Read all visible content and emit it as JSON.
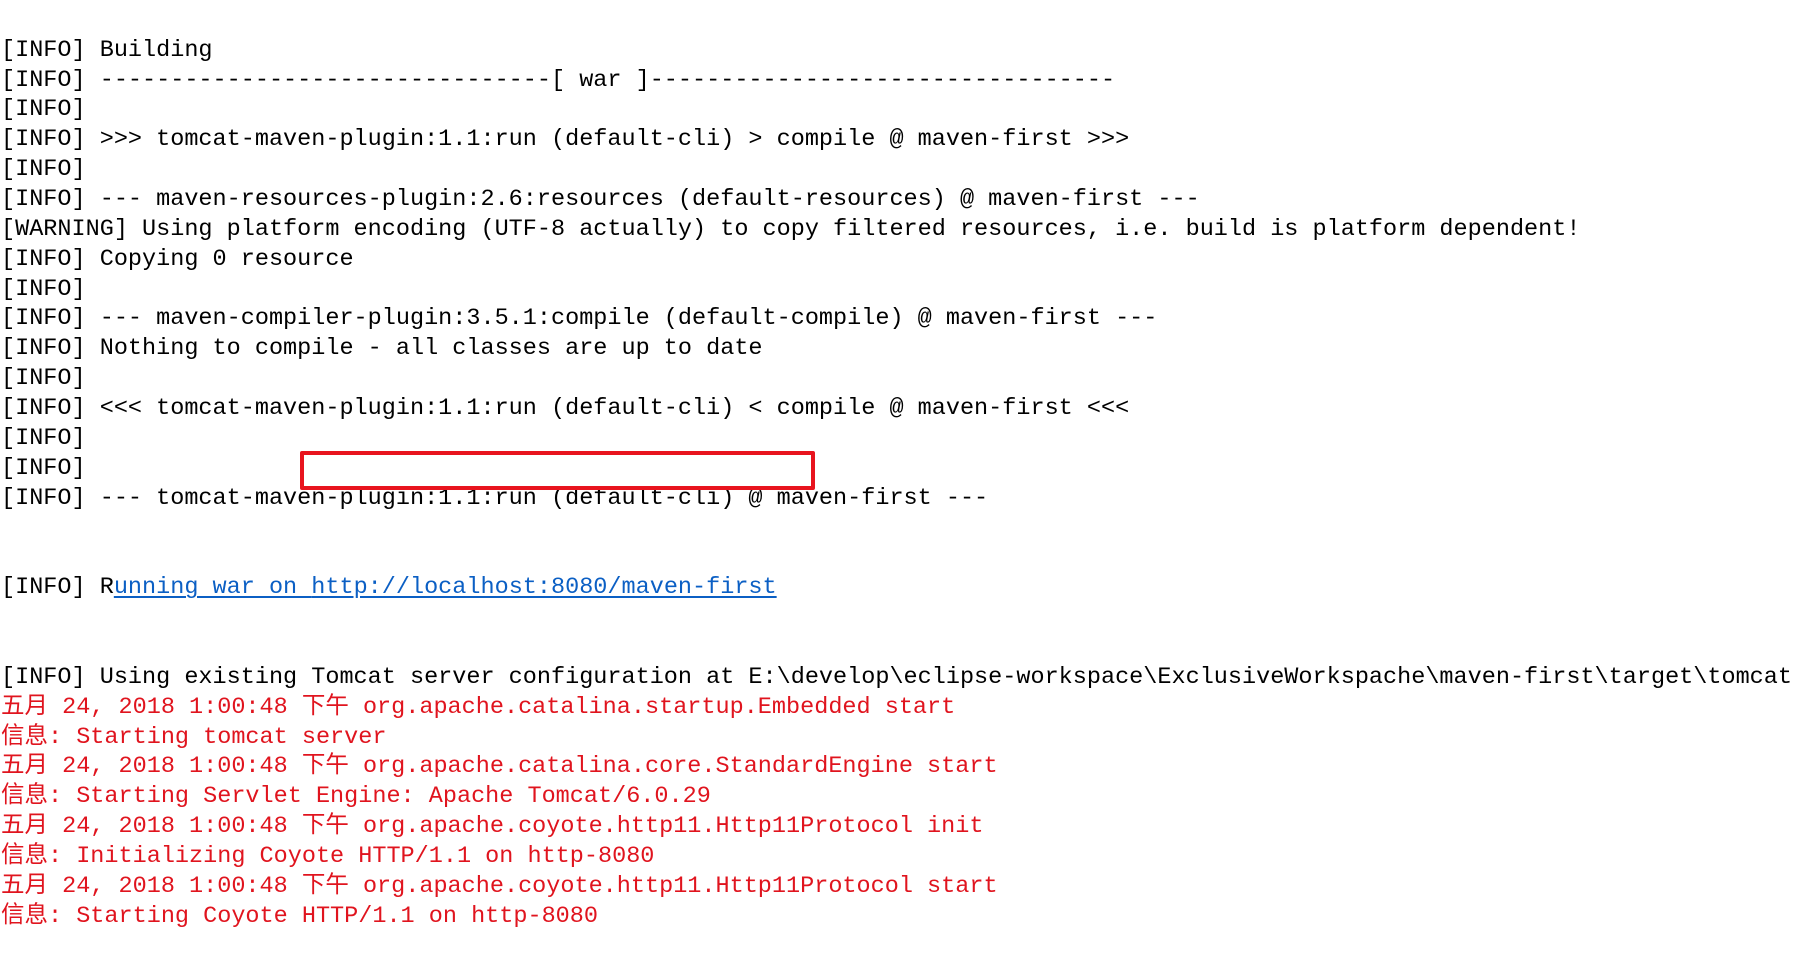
{
  "console": {
    "lines": [
      {
        "text": "[INFO] Building",
        "level": "info"
      },
      {
        "text": "[INFO] --------------------------------[ war ]---------------------------------",
        "level": "info"
      },
      {
        "text": "[INFO]",
        "level": "info"
      },
      {
        "text": "[INFO] >>> tomcat-maven-plugin:1.1:run (default-cli) > compile @ maven-first >>>",
        "level": "info"
      },
      {
        "text": "[INFO]",
        "level": "info"
      },
      {
        "text": "[INFO] --- maven-resources-plugin:2.6:resources (default-resources) @ maven-first ---",
        "level": "info"
      },
      {
        "text": "[WARNING] Using platform encoding (UTF-8 actually) to copy filtered resources, i.e. build is platform dependent!",
        "level": "warning"
      },
      {
        "text": "[INFO] Copying 0 resource",
        "level": "info"
      },
      {
        "text": "[INFO]",
        "level": "info"
      },
      {
        "text": "[INFO] --- maven-compiler-plugin:3.5.1:compile (default-compile) @ maven-first ---",
        "level": "info"
      },
      {
        "text": "[INFO] Nothing to compile - all classes are up to date",
        "level": "info"
      },
      {
        "text": "[INFO]",
        "level": "info"
      },
      {
        "text": "[INFO] <<< tomcat-maven-plugin:1.1:run (default-cli) < compile @ maven-first <<<",
        "level": "info"
      },
      {
        "text": "[INFO]",
        "level": "info"
      },
      {
        "text": "[INFO]",
        "level": "info"
      },
      {
        "text": "[INFO] --- tomcat-maven-plugin:1.1:run (default-cli) @ maven-first ---",
        "level": "info"
      }
    ],
    "running_line": {
      "prefix": "[INFO] R",
      "link_text_lead": "unning war on ",
      "url": "http://localhost:8080/maven-first"
    },
    "after_lines": [
      {
        "text": "[INFO] Using existing Tomcat server configuration at E:\\develop\\eclipse-workspace\\ExclusiveWorkspache\\maven-first\\target\\tomcat",
        "level": "info"
      },
      {
        "text": "五月 24, 2018 1:00:48 下午 org.apache.catalina.startup.Embedded start",
        "level": "stderr"
      },
      {
        "text": "信息: Starting tomcat server",
        "level": "stderr"
      },
      {
        "text": "五月 24, 2018 1:00:48 下午 org.apache.catalina.core.StandardEngine start",
        "level": "stderr"
      },
      {
        "text": "信息: Starting Servlet Engine: Apache Tomcat/6.0.29",
        "level": "stderr"
      },
      {
        "text": "五月 24, 2018 1:00:48 下午 org.apache.coyote.http11.Http11Protocol init",
        "level": "stderr"
      },
      {
        "text": "信息: Initializing Coyote HTTP/1.1 on http-8080",
        "level": "stderr"
      },
      {
        "text": "五月 24, 2018 1:00:48 下午 org.apache.coyote.http11.Http11Protocol start",
        "level": "stderr"
      },
      {
        "text": "信息: Starting Coyote HTTP/1.1 on http-8080",
        "level": "stderr"
      }
    ]
  },
  "colors": {
    "stderr": "#e0141e",
    "link": "#0b5fc4",
    "highlight_box": "#e8141e",
    "text": "#000000"
  }
}
